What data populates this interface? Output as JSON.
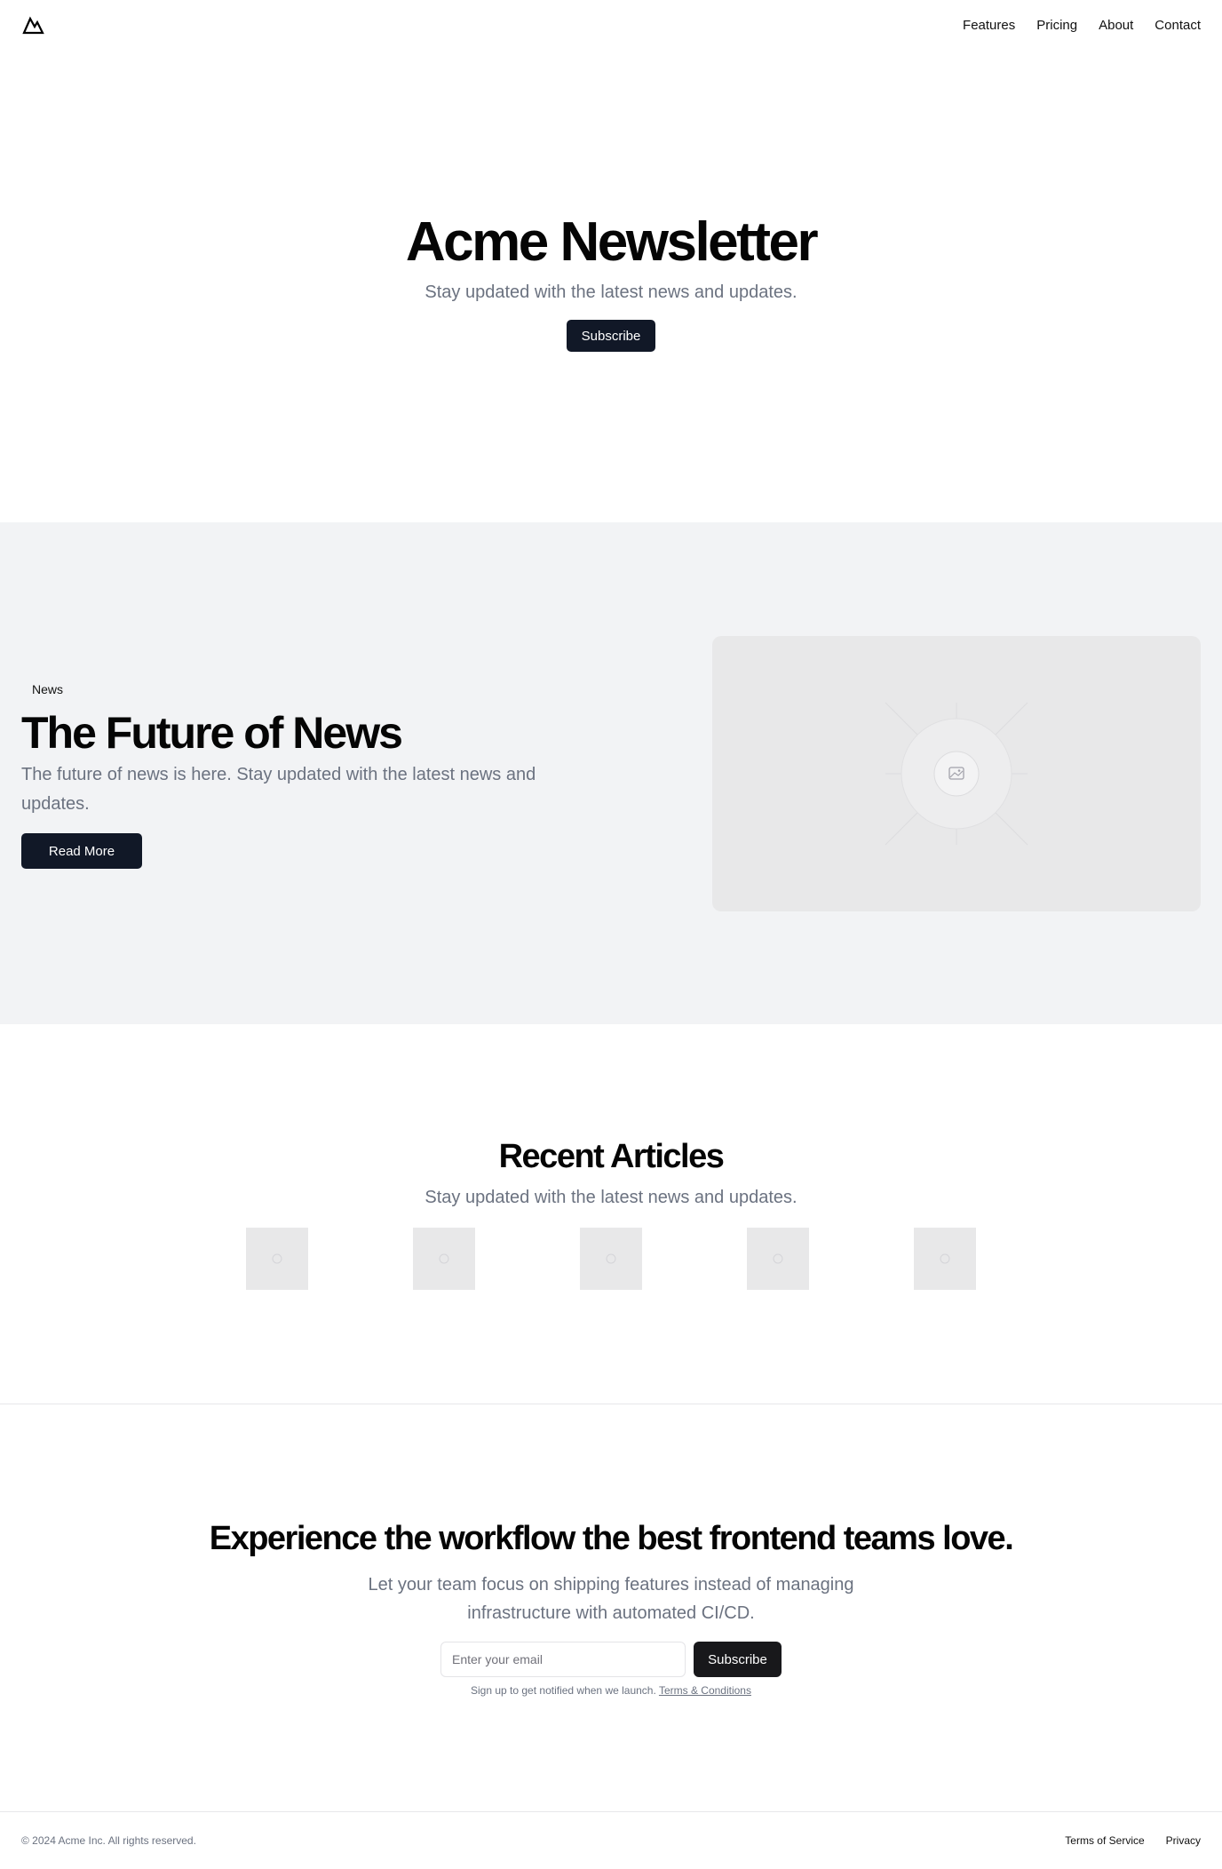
{
  "header": {
    "logo_icon": "mountain-icon",
    "nav": [
      "Features",
      "Pricing",
      "About",
      "Contact"
    ]
  },
  "hero": {
    "title": "Acme Newsletter",
    "subtitle": "Stay updated with the latest news and updates.",
    "button": "Subscribe"
  },
  "featured": {
    "badge": "News",
    "title": "The Future of News",
    "description": "The future of news is here. Stay updated with the latest news and updates.",
    "button": "Read More",
    "image_icon": "image-placeholder-icon"
  },
  "recent": {
    "title": "Recent Articles",
    "subtitle": "Stay updated with the latest news and updates.",
    "thumbnails": 5
  },
  "cta": {
    "title": "Experience the workflow the best frontend teams love.",
    "description": "Let your team focus on shipping features instead of managing infrastructure with automated CI/CD.",
    "email_placeholder": "Enter your email",
    "button": "Subscribe",
    "note": "Sign up to get notified when we launch.",
    "note_link": "Terms & Conditions"
  },
  "footer": {
    "copyright": "© 2024 Acme Inc. All rights reserved.",
    "links": [
      "Terms of Service",
      "Privacy"
    ]
  },
  "colors": {
    "primary_button": "#111827",
    "muted_text": "#6b7280",
    "section_bg": "#f2f3f5",
    "placeholder_bg": "#e8e8e9"
  }
}
